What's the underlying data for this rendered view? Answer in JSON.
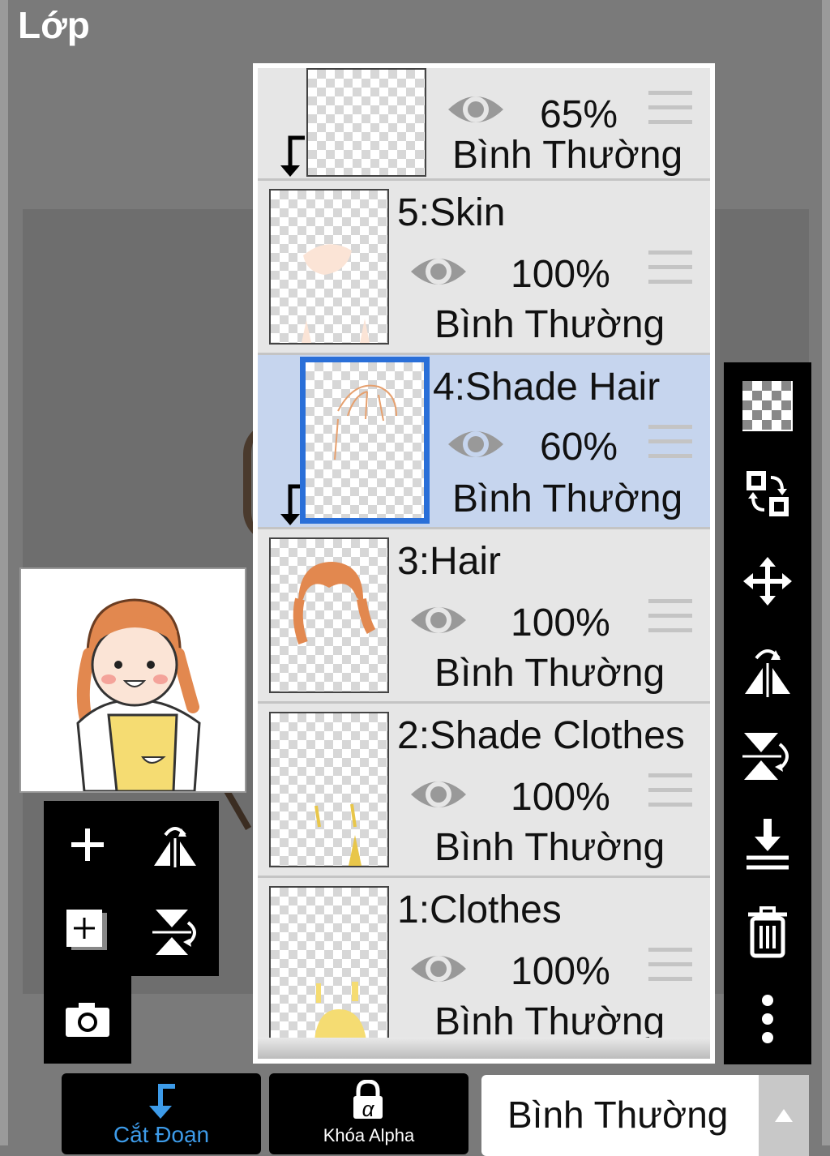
{
  "header": {
    "title": "Lớp"
  },
  "layers": [
    {
      "name": "",
      "opacity": "65%",
      "blend": "Bình Thường",
      "clipped": true,
      "selected": false
    },
    {
      "name": "5:Skin",
      "opacity": "100%",
      "blend": "Bình Thường",
      "clipped": false,
      "selected": false
    },
    {
      "name": "4:Shade Hair",
      "opacity": "60%",
      "blend": "Bình Thường",
      "clipped": true,
      "selected": true
    },
    {
      "name": "3:Hair",
      "opacity": "100%",
      "blend": "Bình Thường",
      "clipped": false,
      "selected": false
    },
    {
      "name": "2:Shade Clothes",
      "opacity": "100%",
      "blend": "Bình Thường",
      "clipped": false,
      "selected": false
    },
    {
      "name": "1:Clothes",
      "opacity": "100%",
      "blend": "Bình Thường",
      "clipped": false,
      "selected": false
    }
  ],
  "bottom": {
    "clip_label": "Cắt Đoạn",
    "alpha_lock_label": "Khóa Alpha",
    "blend_mode_value": "Bình Thường",
    "clip_symbol": "α"
  },
  "colors": {
    "accent": "#2a6fd8",
    "active_label": "#3d9be9",
    "selected_row": "#c6d5ee"
  },
  "icons": {
    "right_toolbar": [
      "transparency-icon",
      "swap-icon",
      "move-icon",
      "flip-horizontal-icon",
      "flip-vertical-icon",
      "merge-down-icon",
      "trash-icon",
      "more-icon"
    ],
    "left_toolbar": [
      "add-layer-icon",
      "flip-horizontal-icon",
      "add-layer-copy-icon",
      "flip-vertical-icon",
      "camera-icon"
    ]
  }
}
